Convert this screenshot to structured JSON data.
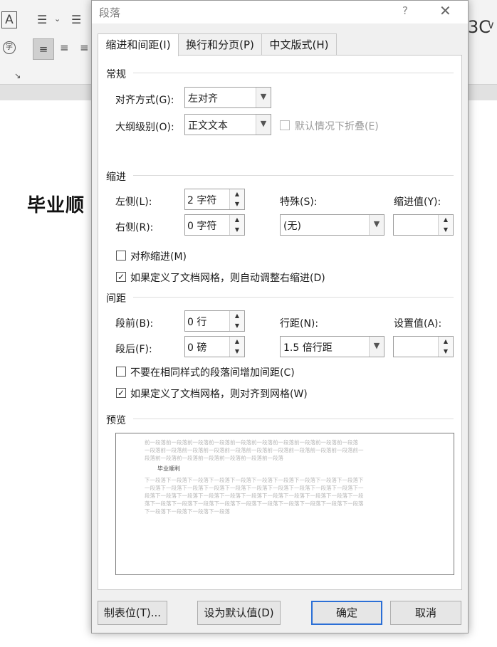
{
  "background": {
    "ribbon": {
      "font_icon": "A",
      "partial_text": "3C",
      "collapse_icon": "∨"
    },
    "document_heading": "毕业顺"
  },
  "dialog": {
    "title": "段落",
    "help": "?",
    "close": "✕",
    "tabs": [
      {
        "label": "缩进和间距(I)",
        "active": true
      },
      {
        "label": "换行和分页(P)",
        "active": false
      },
      {
        "label": "中文版式(H)",
        "active": false
      }
    ],
    "general": {
      "heading": "常规",
      "alignment": {
        "label": "对齐方式(G):",
        "value": "左对齐"
      },
      "outline": {
        "label": "大纲级别(O):",
        "value": "正文文本"
      },
      "collapse": {
        "label": "默认情况下折叠(E)",
        "checked": false,
        "enabled": false
      }
    },
    "indent": {
      "heading": "缩进",
      "left": {
        "label": "左侧(L):",
        "value": "2 字符"
      },
      "right": {
        "label": "右侧(R):",
        "value": "0 字符"
      },
      "special": {
        "label": "特殊(S):",
        "value": "(无)"
      },
      "indent_by": {
        "label": "缩进值(Y):",
        "value": ""
      },
      "mirror": {
        "label": "对称缩进(M)",
        "checked": false
      },
      "auto_adjust": {
        "label": "如果定义了文档网格，则自动调整右缩进(D)",
        "checked": true
      }
    },
    "spacing": {
      "heading": "间距",
      "before": {
        "label": "段前(B):",
        "value": "0 行"
      },
      "after": {
        "label": "段后(F):",
        "value": "0 磅"
      },
      "line_spacing": {
        "label": "行距(N):",
        "value": "1.5 倍行距"
      },
      "at": {
        "label": "设置值(A):",
        "value": ""
      },
      "no_space_same_style": {
        "label": "不要在相同样式的段落间增加间距(C)",
        "checked": false
      },
      "snap_to_grid": {
        "label": "如果定义了文档网格，则对齐到网格(W)",
        "checked": true
      }
    },
    "preview": {
      "heading": "预览",
      "prev_lines": [
        "前一段落前一段落前一段落前一段落前一段落前一段落前一段落前一段落前一段落前一段落",
        "一段落前一段落前一段落前一段落前一段落前一段落前一段落前一段落前一段落前一段落前一",
        "段落前一段落前一段落前一段落前一段落前一段落前一段落"
      ],
      "current": "毕业顺利",
      "next_lines": [
        "下一段落下一段落下一段落下一段落下一段落下一段落下一段落下一段落下一段落下一段落下",
        "一段落下一段落下一段落下一段落下一段落下一段落下一段落下一段落下一段落下一段落下一",
        "段落下一段落下一段落下一段落下一段落下一段落下一段落下一段落下一段落下一段落下一段",
        "落下一段落下一段落下一段落下一段落下一段落下一段落下一段落下一段落下一段落下一段落",
        "下一段落下一段落下一段落下一段落"
      ]
    },
    "buttons": {
      "tabs": "制表位(T)...",
      "set_default": "设为默认值(D)",
      "ok": "确定",
      "cancel": "取消"
    }
  }
}
